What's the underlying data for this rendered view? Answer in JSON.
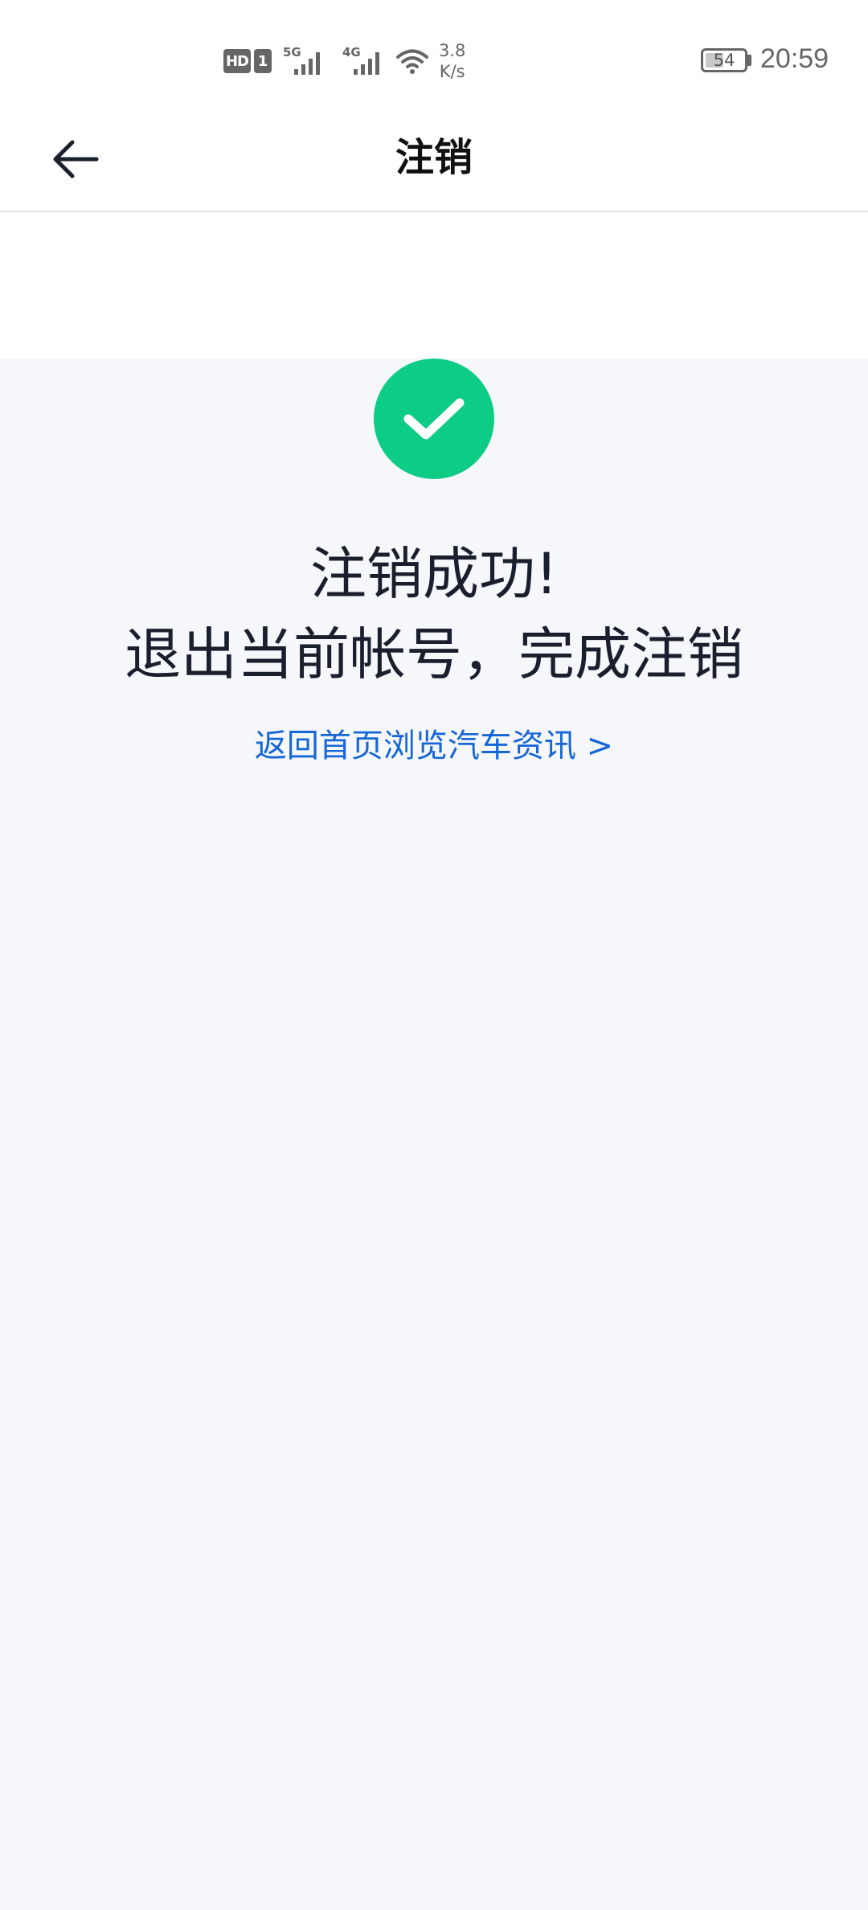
{
  "status_bar": {
    "hd_label": "HD",
    "sim_label": "1",
    "signal1_label": "5G",
    "signal2_label": "4G",
    "speed_value": "3.8",
    "speed_unit": "K/s",
    "battery_level": "54",
    "time": "20:59"
  },
  "header": {
    "title": "注销"
  },
  "main": {
    "headline_line1": "注销成功!",
    "headline_line2": "退出当前帐号，完成注销",
    "link_text": "返回首页浏览汽车资讯 >"
  },
  "colors": {
    "success": "#0ccc86",
    "link": "#1566d6",
    "page_background": "#f6f7fb",
    "text": "#1a1f2e"
  }
}
